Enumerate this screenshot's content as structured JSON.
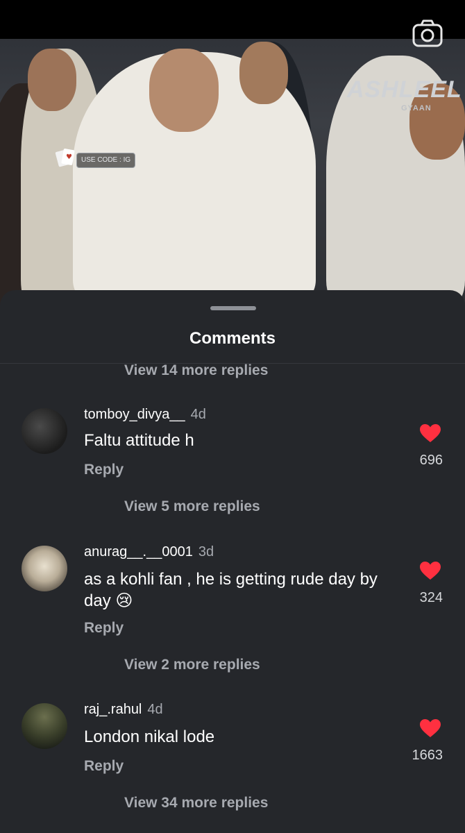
{
  "video": {
    "watermark": "ASHLEEL",
    "watermark_sub": "GYAAN",
    "promo_code": "USE CODE : IG"
  },
  "sheet": {
    "title": "Comments",
    "top_view_more": "View 14 more replies"
  },
  "comments": [
    {
      "username": "tomboy_divya__",
      "time": "4d",
      "text": "Faltu attitude h",
      "reply": "Reply",
      "likes": "696",
      "view_more": "View 5 more replies"
    },
    {
      "username": "anurag__.__0001",
      "time": "3d",
      "text": "as a kohli fan , he is getting rude day by day 😢",
      "reply": "Reply",
      "likes": "324",
      "view_more": "View 2 more replies"
    },
    {
      "username": "raj_.rahul",
      "time": "4d",
      "text": "London nikal lode",
      "reply": "Reply",
      "likes": "1663",
      "view_more": "View 34 more replies"
    }
  ],
  "colors": {
    "sheet_bg": "#25272b",
    "heart": "#ff3040",
    "muted": "#a7aab0"
  }
}
